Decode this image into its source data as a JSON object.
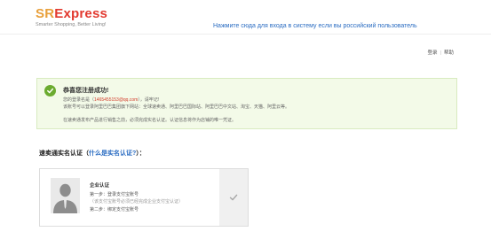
{
  "header": {
    "logo_sr": "SR",
    "logo_express": "Express",
    "tagline": "Smarter Shopping, Better Living!",
    "russian_link": "Нажмите сюда для входа в систему если вы российский пользователь"
  },
  "toplinks": {
    "login": "登录",
    "separator": "|",
    "help": "帮助"
  },
  "success": {
    "title": "恭喜您注册成功!",
    "line1_prefix": "您的登录名是（",
    "email": "1465455153@qq.com",
    "line1_suffix": "），请牢记!",
    "line2": "该账号可以登录阿里巴巴集团旗下网站：全球速卖通、阿里巴巴国际站、阿里巴巴中文站、淘宝、天猫、阿里云等。",
    "line3": "在速卖通发布产品进行销售之前，必须完成实名认证。认证信息将作为店铺的唯一凭证。"
  },
  "section": {
    "title_prefix": "速卖通实名认证（",
    "title_link": "什么是实名认证?",
    "title_suffix": "）："
  },
  "card": {
    "title": "企业认证",
    "step1": "第一步：登录支付宝账号",
    "step1_note": "（该支付宝账号必须已经完成企业支付宝认证）",
    "step2": "第二步：绑定支付宝账号"
  },
  "colors": {
    "brand_orange": "#e8a03b",
    "brand_red": "#e2392f",
    "link_blue": "#2a6cc2",
    "success_green": "#6bab2f"
  },
  "icons": {
    "success": "check-circle-icon",
    "avatar": "user-silhouette-icon",
    "select": "checkmark-icon"
  }
}
